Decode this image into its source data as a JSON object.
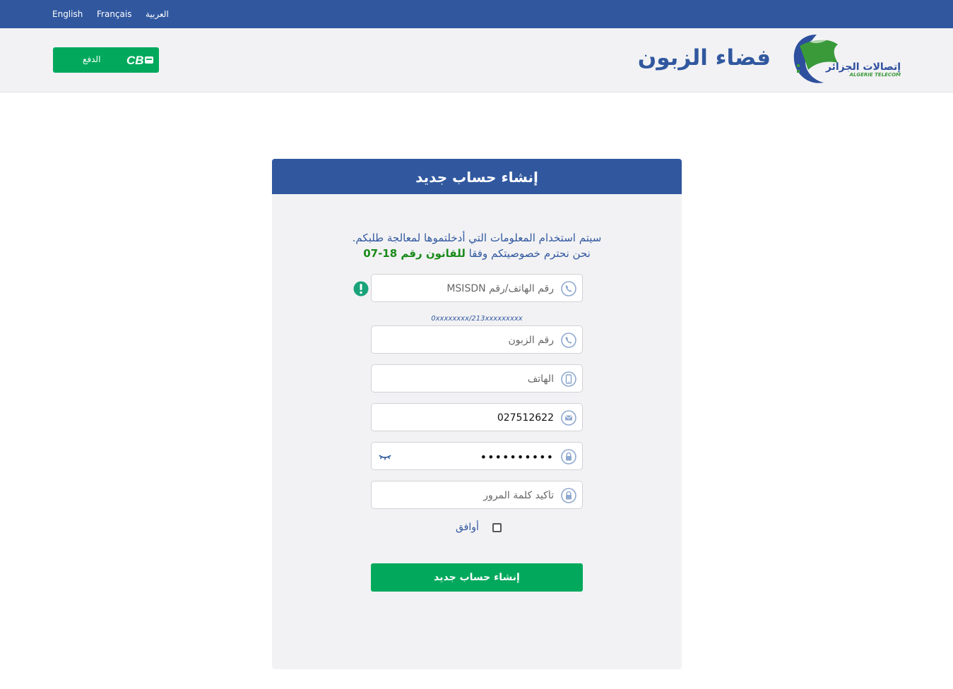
{
  "topbar": {
    "languages": [
      "English",
      "Français",
      "العربية"
    ]
  },
  "header": {
    "site_title": "فضاء الزبون",
    "pay_button_label": "الدفع",
    "pay_logo_text": "CIB",
    "brand_logo_arabic": "إتصالات الجزائر",
    "brand_logo_latin": "ALGERIE TELECOM"
  },
  "form": {
    "title": "إنشاء حساب جديد",
    "info_line1": "سيتم استخدام المعلومات التي أدخلتموها لمعالجة طلبكم.",
    "info_line2_prefix": "نحن نحترم خصوصيتكم وفقا ",
    "info_line2_law": "للقانون رقم 18-07",
    "msisdn": {
      "placeholder": "رقم الهاتف/رقم MSISDN",
      "value": ""
    },
    "msisdn_hint": "0xxxxxxxx/213xxxxxxxxx",
    "customer_number": {
      "placeholder": "رقم الزبون",
      "value": ""
    },
    "phone": {
      "placeholder": "الهاتف",
      "value": ""
    },
    "email": {
      "placeholder": "",
      "value": "027512622"
    },
    "password": {
      "placeholder": "",
      "value": "••••••••••"
    },
    "confirm_password": {
      "placeholder": "تأكيد كلمة المرور",
      "value": ""
    },
    "agree_label": "أوافق",
    "agree_checked": false,
    "submit_label": "إنشاء حساب جديد"
  },
  "colors": {
    "primary_blue": "#31589f",
    "green": "#02a95c",
    "law_green": "#1a8a1a",
    "warning_teal": "#1aa37a",
    "background": "#f2f2f4"
  },
  "icons": [
    "phone-icon",
    "mobile-icon",
    "envelope-icon",
    "lock-icon",
    "eye-closed-icon",
    "warning-icon",
    "cib-logo",
    "algerie-telecom-logo"
  ]
}
